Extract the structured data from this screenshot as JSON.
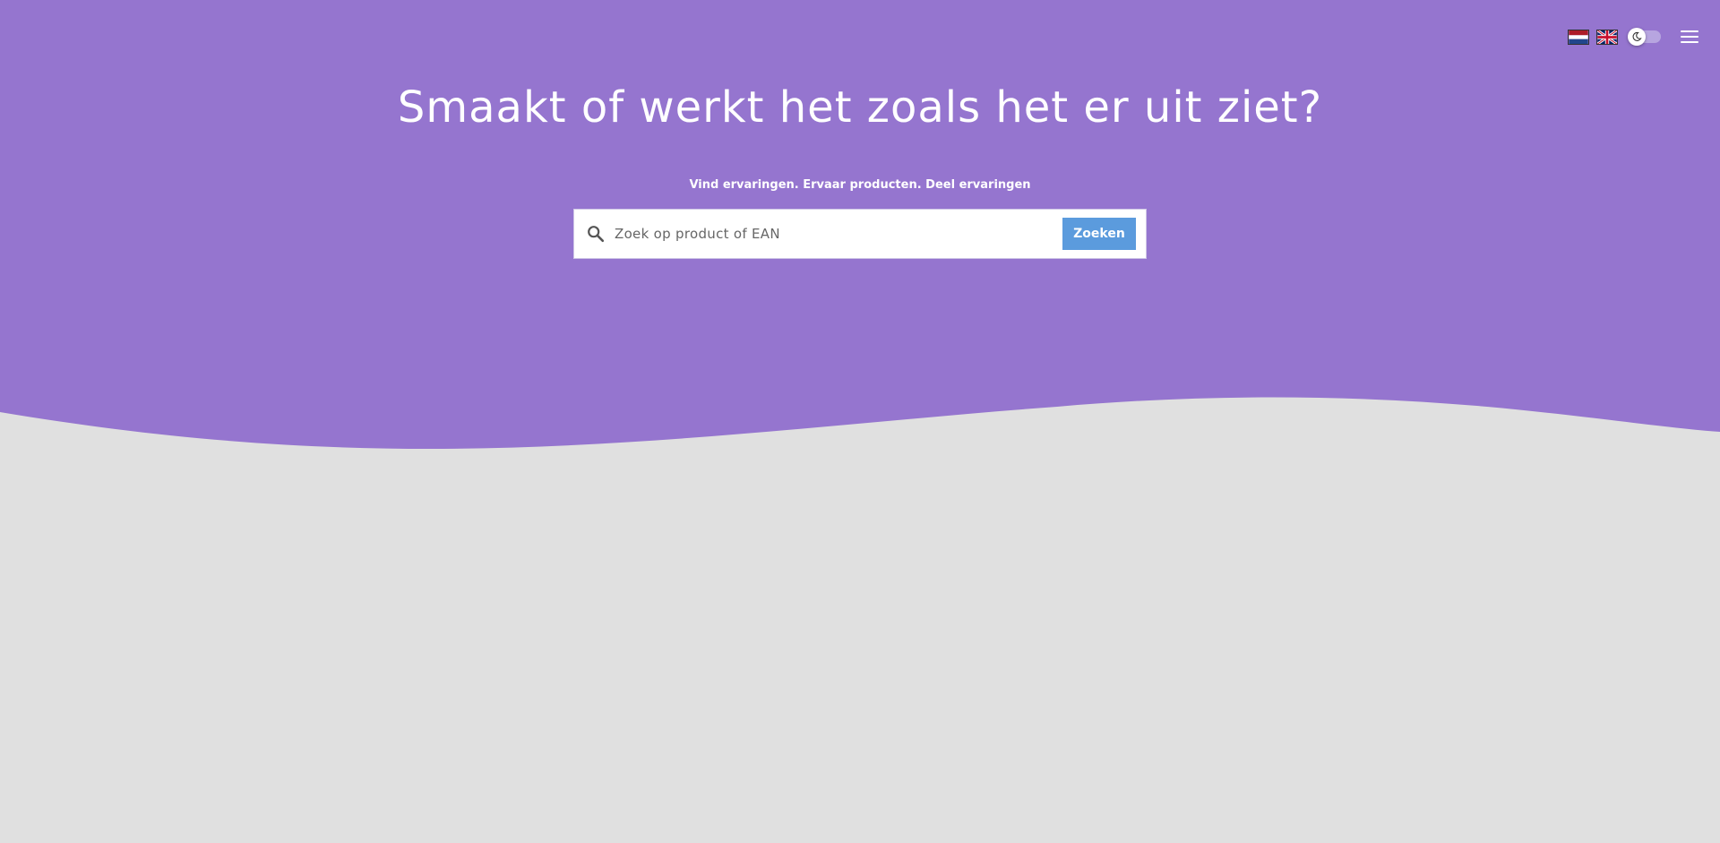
{
  "hero": {
    "headline": "Smaakt of werkt het zoals het er uit ziet?",
    "tagline": "Vind ervaringen. Ervaar producten. Deel ervaringen"
  },
  "search": {
    "placeholder": "Zoek op product of EAN",
    "value": "",
    "button_label": "Zoeken"
  },
  "top_controls": {
    "languages": [
      "nl-flag-icon",
      "uk-flag-icon"
    ],
    "dark_mode_toggle": "off",
    "menu_icon": "hamburger-menu-icon"
  },
  "colors": {
    "hero_background": "#9575cf",
    "page_background": "#e0e0e0",
    "button_background": "#5b9bdd",
    "text_on_hero": "#ffffff"
  }
}
